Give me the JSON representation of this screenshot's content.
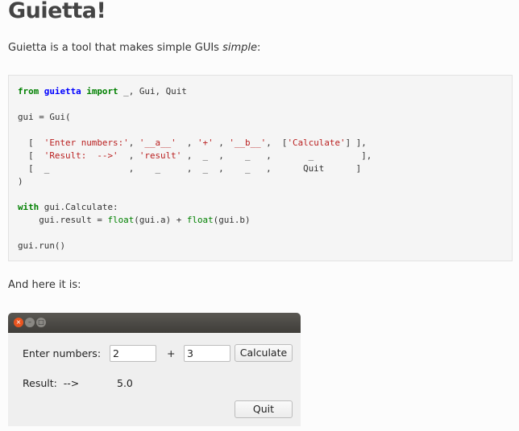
{
  "title": "Guietta!",
  "intro": {
    "before": "Guietta is a tool that makes simple GUIs ",
    "emph": "simple",
    "after": ":"
  },
  "code": [
    [
      {
        "t": "kw",
        "s": "from"
      },
      {
        "t": "",
        "s": " "
      },
      {
        "t": "mod",
        "s": "guietta"
      },
      {
        "t": "",
        "s": " "
      },
      {
        "t": "kw",
        "s": "import"
      },
      {
        "t": "",
        "s": " _, Gui, Quit"
      }
    ],
    [],
    [
      {
        "t": "",
        "s": "gui = Gui("
      }
    ],
    [],
    [
      {
        "t": "",
        "s": "  [  "
      },
      {
        "t": "str",
        "s": "'Enter numbers:'"
      },
      {
        "t": "",
        "s": ", "
      },
      {
        "t": "str",
        "s": "'__a__'"
      },
      {
        "t": "",
        "s": "  , "
      },
      {
        "t": "str",
        "s": "'+'"
      },
      {
        "t": "",
        "s": " , "
      },
      {
        "t": "str",
        "s": "'__b__'"
      },
      {
        "t": "",
        "s": ",  ["
      },
      {
        "t": "str",
        "s": "'Calculate'"
      },
      {
        "t": "",
        "s": "] ],"
      }
    ],
    [
      {
        "t": "",
        "s": "  [  "
      },
      {
        "t": "str",
        "s": "'Result:  -->'"
      },
      {
        "t": "",
        "s": "  , "
      },
      {
        "t": "str",
        "s": "'result'"
      },
      {
        "t": "",
        "s": " ,  _  ,    _   ,       _         ],"
      }
    ],
    [
      {
        "t": "",
        "s": "  [  _               ,    _     ,  _  ,    _   ,      Quit      ]"
      }
    ],
    [
      {
        "t": "",
        "s": ")"
      }
    ],
    [],
    [
      {
        "t": "kw",
        "s": "with"
      },
      {
        "t": "",
        "s": " gui.Calculate:"
      }
    ],
    [
      {
        "t": "",
        "s": "    gui.result = "
      },
      {
        "t": "bi",
        "s": "float"
      },
      {
        "t": "",
        "s": "(gui.a) + "
      },
      {
        "t": "bi",
        "s": "float"
      },
      {
        "t": "",
        "s": "(gui.b)"
      }
    ],
    [],
    [
      {
        "t": "",
        "s": "gui.run()"
      }
    ]
  ],
  "here_text": "And here it is:",
  "window": {
    "enter_label": "Enter numbers:",
    "a_value": "2",
    "plus_label": "+",
    "b_value": "3",
    "calculate_label": "Calculate",
    "result_label": "Result:  -->",
    "result_value": "5.0",
    "quit_label": "Quit",
    "close_glyph": "×",
    "min_glyph": "–",
    "max_glyph": "□"
  }
}
